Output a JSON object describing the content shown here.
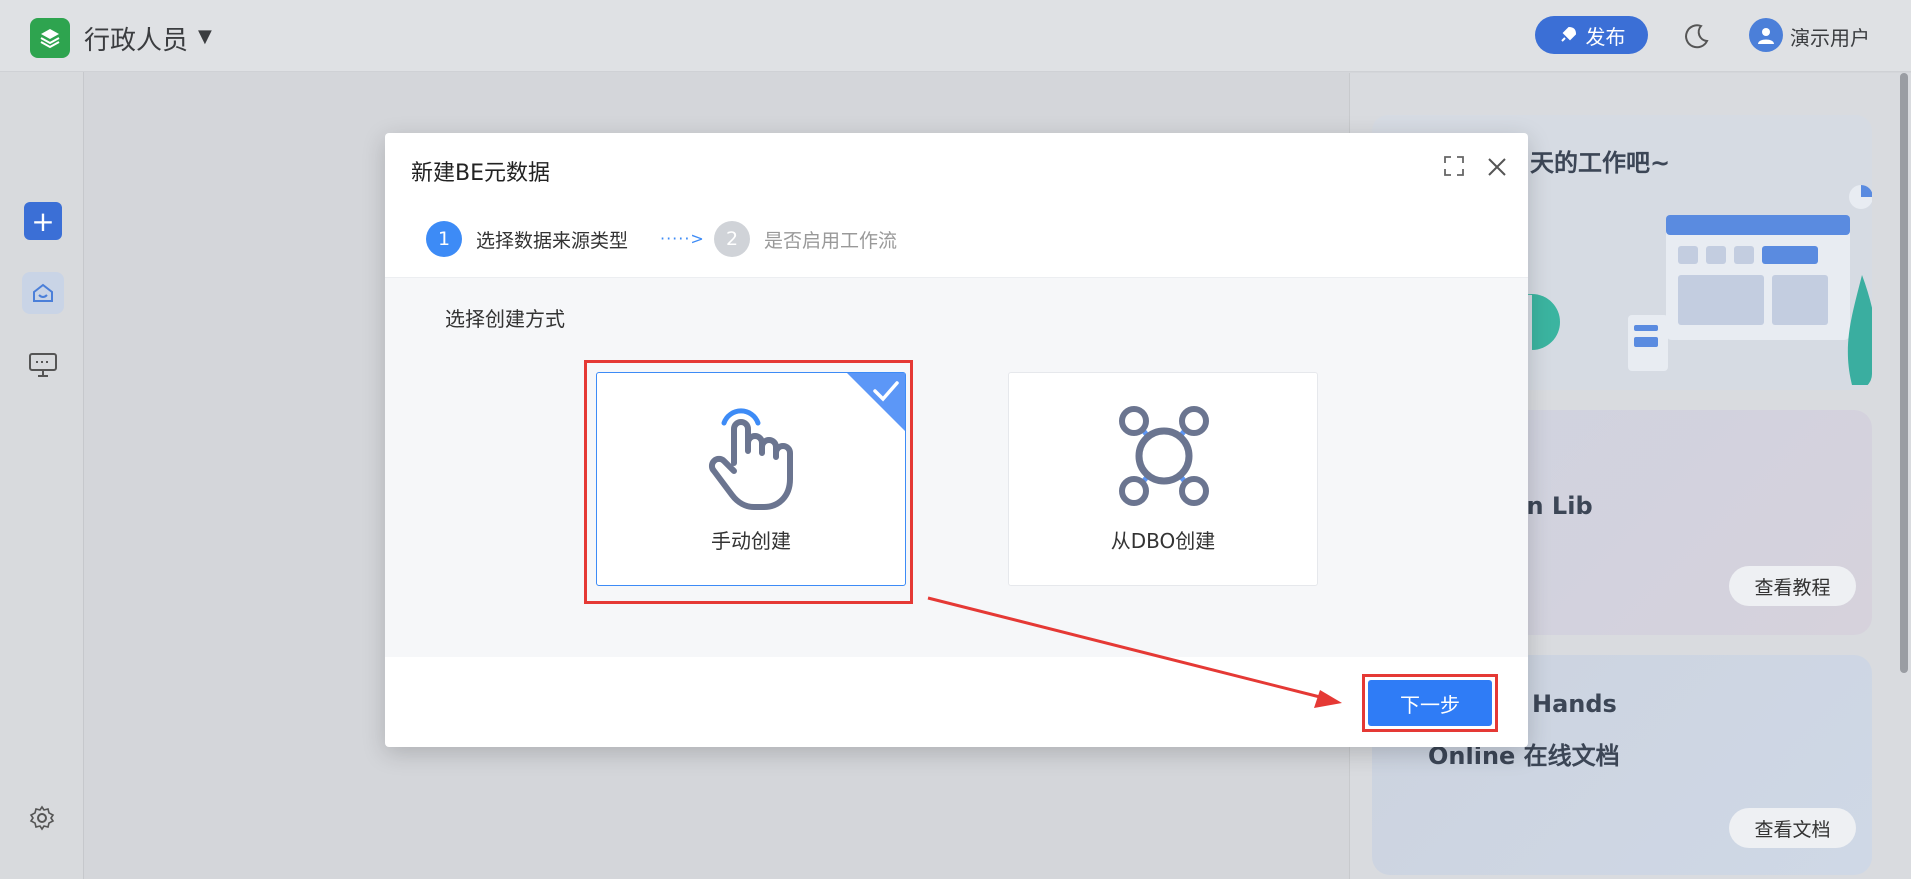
{
  "header": {
    "app_title": "行政人员",
    "caret": "▼",
    "publish_label": "发布",
    "user_name": "演示用户"
  },
  "right_panel": {
    "card1_text": "天的工作吧~",
    "card2_text": "on Lib",
    "card2_button": "查看教程",
    "card3_line1": "Hands",
    "card3_line2": "Online 在线文档",
    "card3_button": "查看文档"
  },
  "modal": {
    "title": "新建BE元数据",
    "steps": [
      {
        "num": "1",
        "label": "选择数据来源类型",
        "active": true
      },
      {
        "num": "2",
        "label": "是否启用工作流",
        "active": false
      }
    ],
    "step_arrow": "·····>",
    "choose_label": "选择创建方式",
    "options": [
      {
        "label": "手动创建",
        "selected": true
      },
      {
        "label": "从DBO创建",
        "selected": false
      }
    ],
    "next_label": "下一步"
  },
  "colors": {
    "accent": "#2f7cf6",
    "highlight_red": "#e53935",
    "icon_gray": "#6b7590"
  }
}
